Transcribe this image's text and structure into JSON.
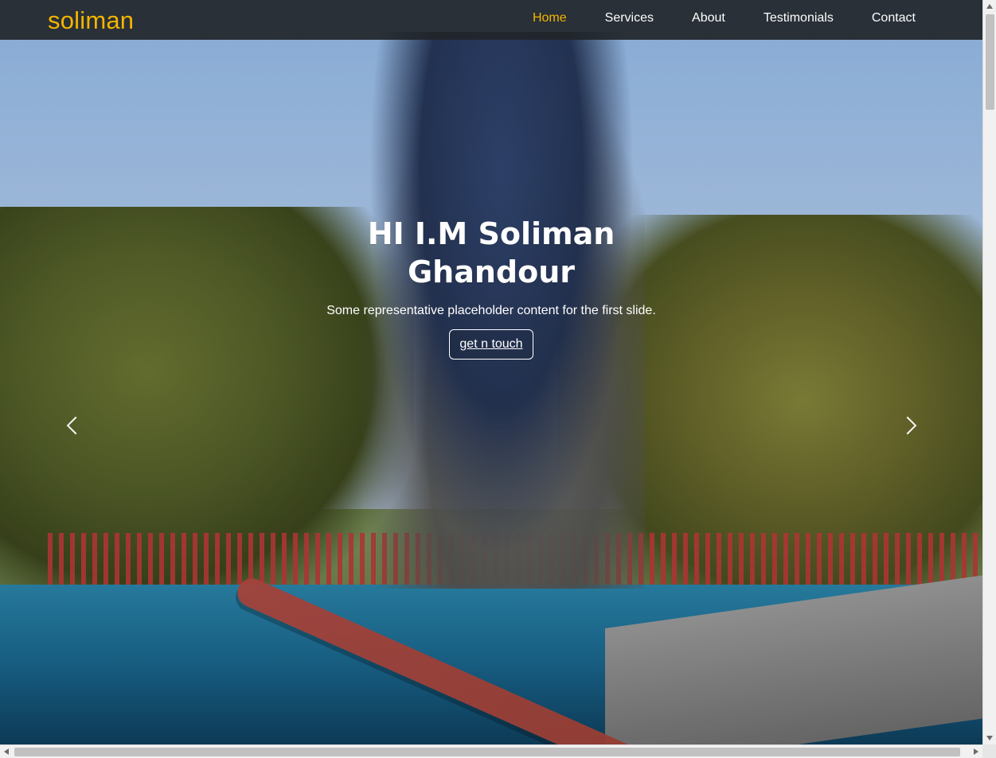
{
  "brand": {
    "name": "soliman"
  },
  "nav": {
    "items": [
      "Home",
      "Services",
      "About",
      "Testimonials",
      "Contact"
    ],
    "active_index": 0
  },
  "hero": {
    "title": "HI I.M Soliman Ghandour",
    "subtitle": "Some representative placeholder content for the first slide.",
    "cta_label": "get n touch"
  },
  "colors": {
    "accent": "#f4b400",
    "navbar_bg": "#212529",
    "text": "#ffffff"
  },
  "icons": {
    "carousel_prev": "chevron-left-icon",
    "carousel_next": "chevron-right-icon"
  }
}
